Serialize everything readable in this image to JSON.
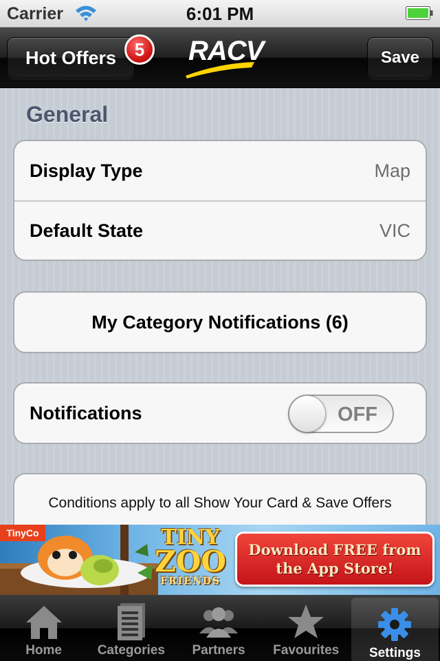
{
  "status_bar": {
    "carrier": "Carrier",
    "time": "6:01 PM",
    "icons": [
      "wifi-icon",
      "battery-icon"
    ]
  },
  "nav_bar": {
    "left_button": "Hot Offers",
    "badge_count": "5",
    "logo_text": "RACV",
    "right_button": "Save",
    "colors": {
      "badge": "#d11a1a",
      "logo_swoosh": "#ffd400"
    }
  },
  "settings": {
    "section_header": "General",
    "general_rows": [
      {
        "label": "Display Type",
        "value": "Map"
      },
      {
        "label": "Default State",
        "value": "VIC"
      }
    ],
    "category_notifications": "My Category Notifications (6)",
    "notifications": {
      "label": "Notifications",
      "toggle_state": "OFF"
    },
    "conditions": "Conditions apply to all Show Your Card & Save Offers"
  },
  "ad_banner": {
    "publisher": "TinyCo",
    "game_title_line1": "TINY",
    "game_title_line2": "ZOO",
    "game_title_line3": "FRIENDS",
    "cta_line1": "Download FREE from",
    "cta_line2": "the App Store!"
  },
  "tab_bar": {
    "tabs": [
      {
        "label": "Home",
        "icon": "home-icon"
      },
      {
        "label": "Categories",
        "icon": "categories-icon"
      },
      {
        "label": "Partners",
        "icon": "partners-icon"
      },
      {
        "label": "Favourites",
        "icon": "star-icon"
      },
      {
        "label": "Settings",
        "icon": "gear-icon"
      }
    ],
    "selected": "Settings",
    "colors": {
      "selected_icon": "#3b8ee8",
      "inactive_icon": "#8a8a8a"
    }
  }
}
